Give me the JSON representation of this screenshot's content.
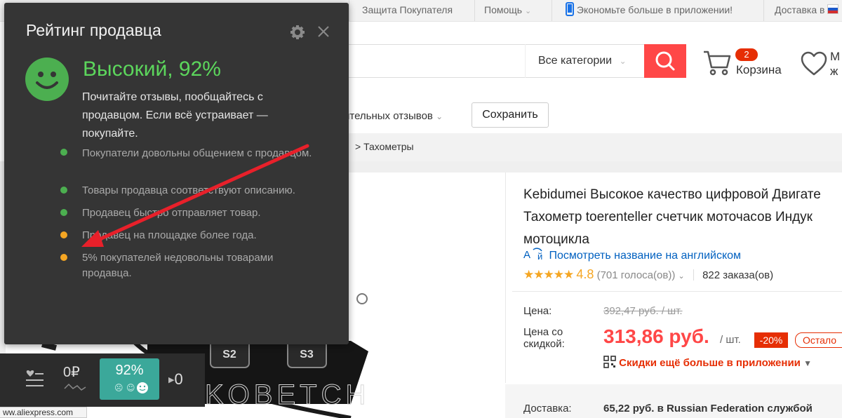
{
  "topbar": {
    "protection": "Защита Покупателя",
    "help": "Помощь",
    "app_promo": "Экономьте больше в приложении!",
    "delivery": "Доставка в"
  },
  "header": {
    "category_select": "Все категории",
    "cart_count": "2",
    "cart_label": "Корзина",
    "wishlist_label_1": "М",
    "wishlist_label_2": "ж"
  },
  "filters": {
    "reviews_filter": "ительных отзывов",
    "save_button": "Сохранить"
  },
  "breadcrumb": {
    "sep": ">",
    "last": "Тахометры"
  },
  "product": {
    "title_line1": "Kebidumei Высокое качество цифровой Двигате",
    "title_line2": "Тахометр toerenteller счетчик моточасов Индук",
    "title_line3": "мотоцикла",
    "view_english": "Посмотреть название на английском",
    "rating_value": "4.8",
    "votes": "(701 голоса(ов))",
    "orders": "822 заказа(ов)",
    "price_label": "Цена:",
    "old_price": "392,47 руб. / шт.",
    "discount_label_1": "Цена со",
    "discount_label_2": "скидкой:",
    "new_price": "313,86 руб.",
    "unit": "/ шт.",
    "discount": "-20%",
    "remaining": "Остало",
    "app_discount": "Скидки ещё больше в приложении",
    "delivery_label": "Доставка:",
    "delivery_value": "65,22 руб. в Russian Federation службой"
  },
  "popup": {
    "title": "Рейтинг продавца",
    "headline": "Высокий, 92%",
    "description": "Почитайте отзывы, пообщайтесь с продавцом. Если всё устраивает — покупайте.",
    "bullets": [
      {
        "text": "Покупатели довольны общением с продавцом.",
        "color": "#4caf50"
      },
      {
        "text": "Товары продавца соответствуют описанию.",
        "color": "#4caf50"
      },
      {
        "text": "Продавец быстро отправляет товар.",
        "color": "#4caf50"
      },
      {
        "text": "Продавец на площадке более года.",
        "color": "#f5a623"
      },
      {
        "text": "5% покупателей недовольны товарами продавца.",
        "color": "#f5a623"
      }
    ]
  },
  "widget": {
    "price": "0₽",
    "rating": "92%",
    "count": "0"
  },
  "image_buttons": {
    "s2": "S2",
    "s3": "S3"
  },
  "watermark": "KOBETCH",
  "status_url": "ww.aliexpress.com",
  "colors": {
    "accent_red": "#ff4747",
    "popup_bg": "#353535",
    "positive_green": "#5cd65c",
    "warning_orange": "#f5a623",
    "widget_teal": "#3ba89a",
    "arrow_red": "#e8202a"
  }
}
